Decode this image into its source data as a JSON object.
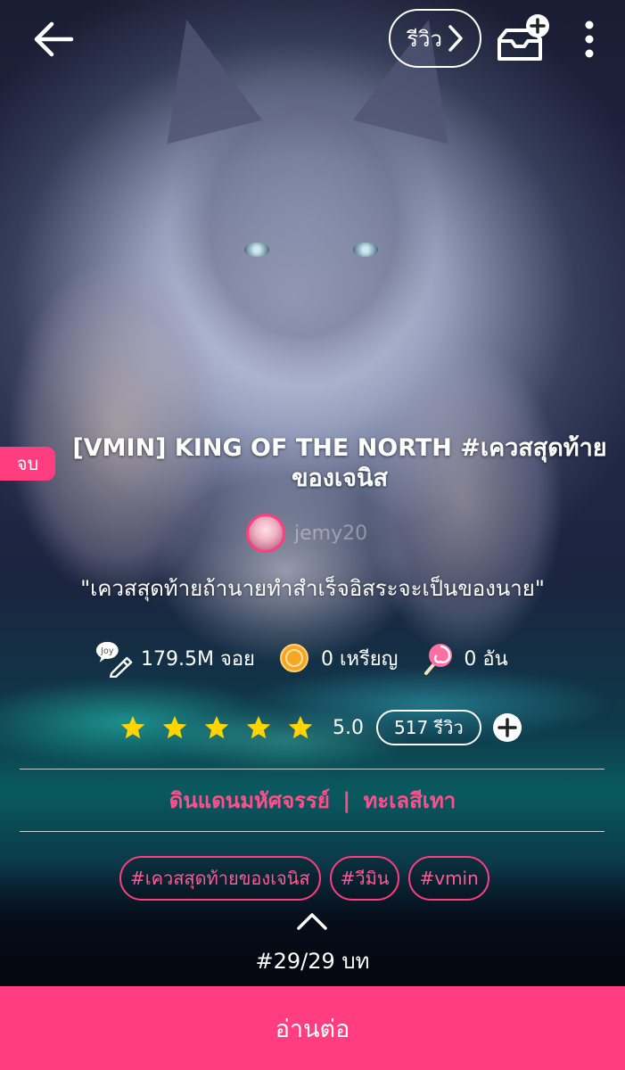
{
  "header": {
    "review_label": "รีวิว"
  },
  "novel": {
    "status": "จบ",
    "title": "[VMIN] KING OF THE NORTH #เควสสุดท้ายของเจนิส",
    "author": "jemy20",
    "tagline": "\"เควสสุดท้ายถ้านายทำสำเร็จอิสระจะเป็นของนาย\""
  },
  "stats": {
    "joy": "179.5M จอย",
    "coins": "0 เหรียญ",
    "candy": "0 อัน"
  },
  "rating": {
    "stars": 5,
    "value": "5.0",
    "review_count": "517 รีวิว"
  },
  "categories": {
    "primary": "ดินแดนมหัศจรรย์",
    "separator": "|",
    "secondary": "ทะเลสีเทา"
  },
  "tags": [
    "#เควสสุดท้ายของเจนิส",
    "#วีมิน",
    "#vmin"
  ],
  "chapters": {
    "label": "#29/29 บท"
  },
  "actions": {
    "read_continue": "อ่านต่อ"
  },
  "colors": {
    "accent": "#ff3d7f",
    "star": "#ffd400"
  }
}
